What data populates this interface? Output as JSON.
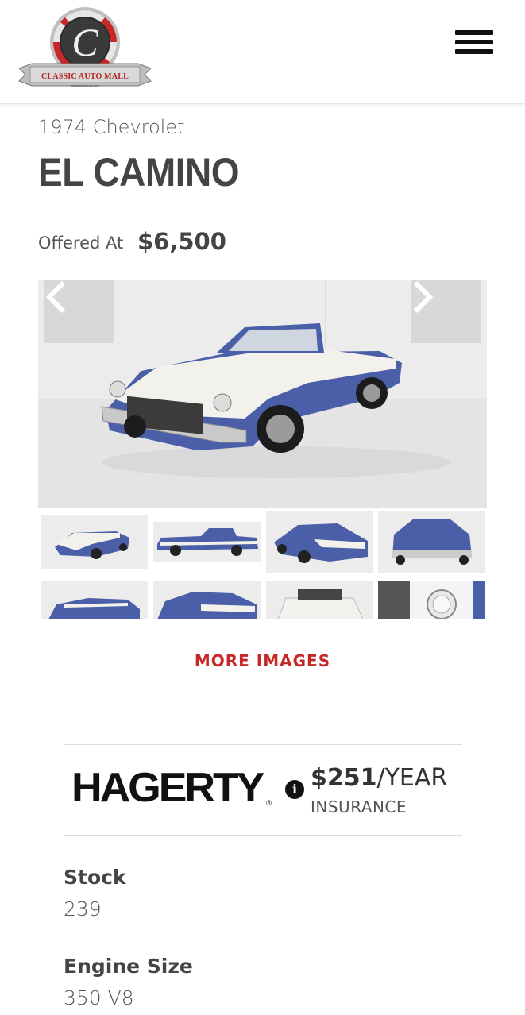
{
  "header": {
    "logo_text": "CLASSIC AUTO MALL",
    "logo_letter": "C",
    "logo_subtext": "classicautomall.com",
    "menu_icon": "hamburger-menu-icon"
  },
  "vehicle": {
    "year_make": "1974 Chevrolet",
    "model": "EL CAMINO",
    "offered_label": "Offered At",
    "price": "$6,500"
  },
  "gallery": {
    "prev_icon": "chevron-left-icon",
    "next_icon": "chevron-right-icon",
    "thumbnail_count": 8,
    "more_images_label": "MORE IMAGES"
  },
  "insurance": {
    "brand": "HAGERTY",
    "registered": "®",
    "info_icon": "info-icon",
    "info_glyph": "i",
    "price": "$251",
    "period": "/YEAR",
    "label": "INSURANCE"
  },
  "specs": [
    {
      "label": "Stock",
      "value": "239"
    },
    {
      "label": "Engine Size",
      "value": "350 V8"
    }
  ],
  "colors": {
    "accent_red": "#c62828",
    "text_dark": "#444444",
    "car_blue": "#4a5fa8",
    "car_white": "#f2f1ec"
  }
}
